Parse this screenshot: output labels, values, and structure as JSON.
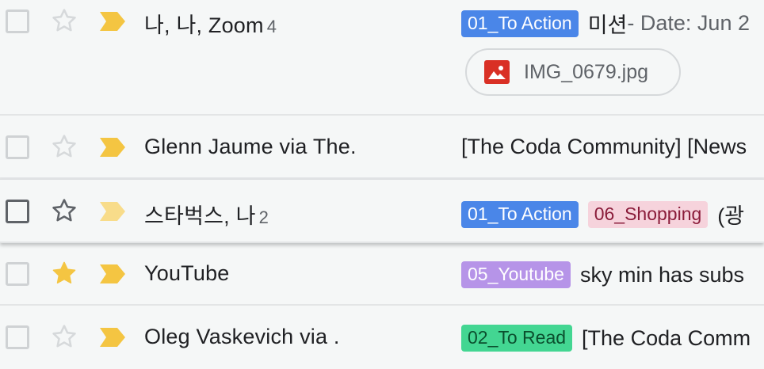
{
  "colors": {
    "star_filled": "#f4c542",
    "star_empty": "#d6d9db",
    "important_marker": "#f4c542",
    "important_marker_faded": "#f8dc8a"
  },
  "rows": [
    {
      "sender": "나, 나, Zoom",
      "count": "4",
      "labels": [
        {
          "text": "01_To Action",
          "bg": "#4a86e8",
          "fg": "#ffffff"
        }
      ],
      "subject": "미션",
      "snippet": " - Date: Jun 2",
      "attachment": "IMG_0679.jpg",
      "starred": false
    },
    {
      "sender": "Glenn Jaume via The.",
      "count": "",
      "labels": [],
      "subject": "[The Coda Community] [News",
      "snippet": "",
      "starred": false
    },
    {
      "sender": "스타벅스, 나",
      "count": "2",
      "labels": [
        {
          "text": "01_To Action",
          "bg": "#4a86e8",
          "fg": "#ffffff"
        },
        {
          "text": "06_Shopping",
          "bg": "#f6d3dc",
          "fg": "#8a1c3a"
        }
      ],
      "subject": "(광",
      "snippet": "",
      "starred": false
    },
    {
      "sender": "YouTube",
      "count": "",
      "labels": [
        {
          "text": "05_Youtube",
          "bg": "#b694e8",
          "fg": "#ffffff"
        }
      ],
      "subject": "sky min has subs",
      "snippet": "",
      "starred": true
    },
    {
      "sender": "Oleg Vaskevich via .",
      "count": "",
      "labels": [
        {
          "text": "02_To Read",
          "bg": "#43d692",
          "fg": "#0b4f2e"
        }
      ],
      "subject": "[The Coda Comm",
      "snippet": "",
      "starred": false
    }
  ]
}
